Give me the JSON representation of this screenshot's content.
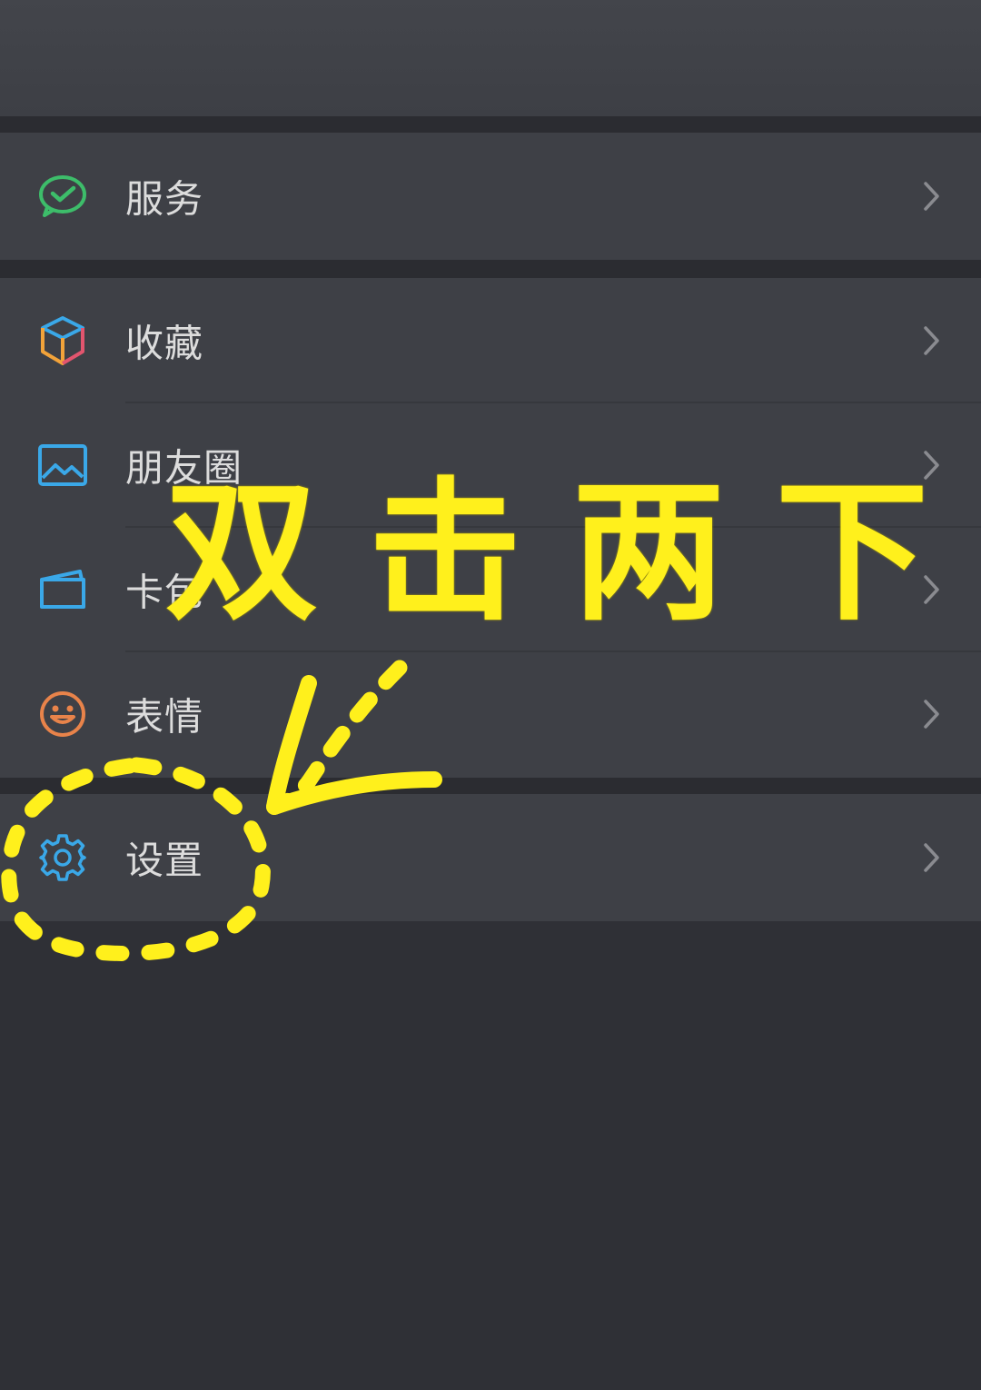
{
  "menu": {
    "service": {
      "label": "服务",
      "icon": "wechat-pay-icon"
    },
    "favorites": {
      "label": "收藏",
      "icon": "cube-icon"
    },
    "moments": {
      "label": "朋友圈",
      "icon": "photo-icon"
    },
    "cards": {
      "label": "卡包",
      "icon": "card-icon"
    },
    "stickers": {
      "label": "表情",
      "icon": "smiley-icon"
    },
    "settings": {
      "label": "设置",
      "icon": "gear-icon"
    }
  },
  "overlay": {
    "chars": [
      "双",
      "击",
      "两",
      "下"
    ]
  },
  "colors": {
    "background": "#2f3036",
    "row": "#3e4046",
    "highlight": "#fff01c",
    "service_icon": "#3dbd6a",
    "settings_icon": "#3aa8e8"
  }
}
